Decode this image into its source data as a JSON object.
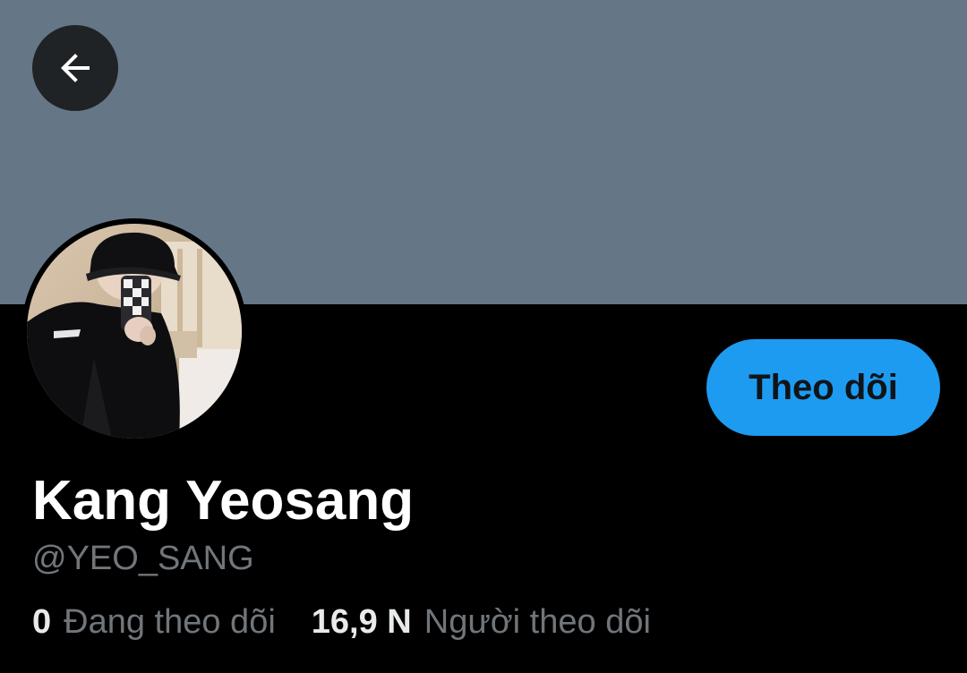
{
  "header": {
    "back_icon": "arrow-left-icon",
    "banner_color": "#657786"
  },
  "profile": {
    "display_name": "Kang Yeosang",
    "handle": "@YEO_SANG",
    "follow_label": "Theo dõi",
    "follow_color": "#1d9bf0"
  },
  "stats": {
    "following_count": "0",
    "following_label": "Đang theo dõi",
    "followers_count": "16,9 N",
    "followers_label": "Người theo dõi"
  }
}
